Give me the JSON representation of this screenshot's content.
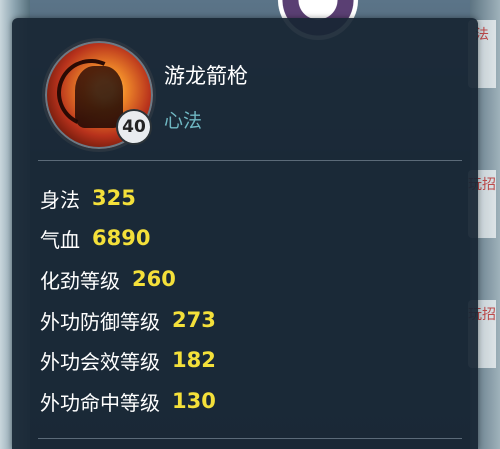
{
  "skill": {
    "name": "游龙箭枪",
    "category": "心法",
    "level": "40"
  },
  "side_tabs": [
    "法",
    "玩招",
    "玩招"
  ],
  "stats": [
    {
      "label": "身法",
      "value": "325"
    },
    {
      "label": "气血",
      "value": "6890"
    },
    {
      "label": "化劲等级",
      "value": "260"
    },
    {
      "label": "外功防御等级",
      "value": "273"
    },
    {
      "label": "外功会效等级",
      "value": "182"
    },
    {
      "label": "外功命中等级",
      "value": "130"
    }
  ],
  "colors": {
    "panel_bg": "#182634",
    "value_yellow": "#f4e03a",
    "category_teal": "#6fb7c2",
    "label_white": "#ffffff"
  }
}
